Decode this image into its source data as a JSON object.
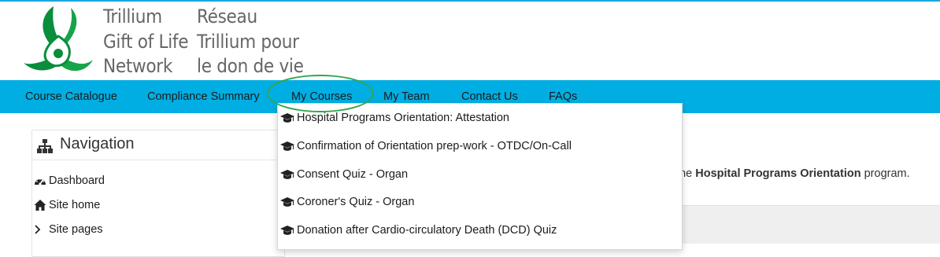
{
  "logo": {
    "english": [
      "Trillium",
      "Gift of Life",
      "Network"
    ],
    "french": [
      "Réseau",
      "Trillium pour",
      "le don de vie"
    ],
    "icon": "trillium-logo"
  },
  "navbar": {
    "items": [
      "Course Catalogue",
      "Compliance Summary",
      "My Courses",
      "My Team",
      "Contact Us",
      "FAQs"
    ],
    "highlighted": "My Courses",
    "background": "#00aee3"
  },
  "navigation_block": {
    "title": "Navigation",
    "title_icon": "sitemap-icon",
    "items": [
      {
        "label": "Dashboard",
        "icon": "tachometer-icon"
      },
      {
        "label": "Site home",
        "icon": "home-icon"
      },
      {
        "label": "Site pages",
        "icon": "chevron-right-icon"
      }
    ]
  },
  "dropdown": {
    "item_icon": "graduation-cap-icon",
    "items": [
      "Hospital Programs Orientation: Attestation",
      "Confirmation of Orientation prep-work - OTDC/On-Call",
      "Consent Quiz - Organ",
      "Coroner's Quiz - Organ",
      "Donation after Cardio-circulatory Death (DCD) Quiz"
    ]
  },
  "main_text": {
    "prefix": "e the ",
    "bold": "Hospital Programs Orientation",
    "suffix": " program."
  },
  "colors": {
    "nav_bar": "#00aee3",
    "logo_green": "#0a8d3c",
    "highlight_circle": "#37a44b"
  }
}
